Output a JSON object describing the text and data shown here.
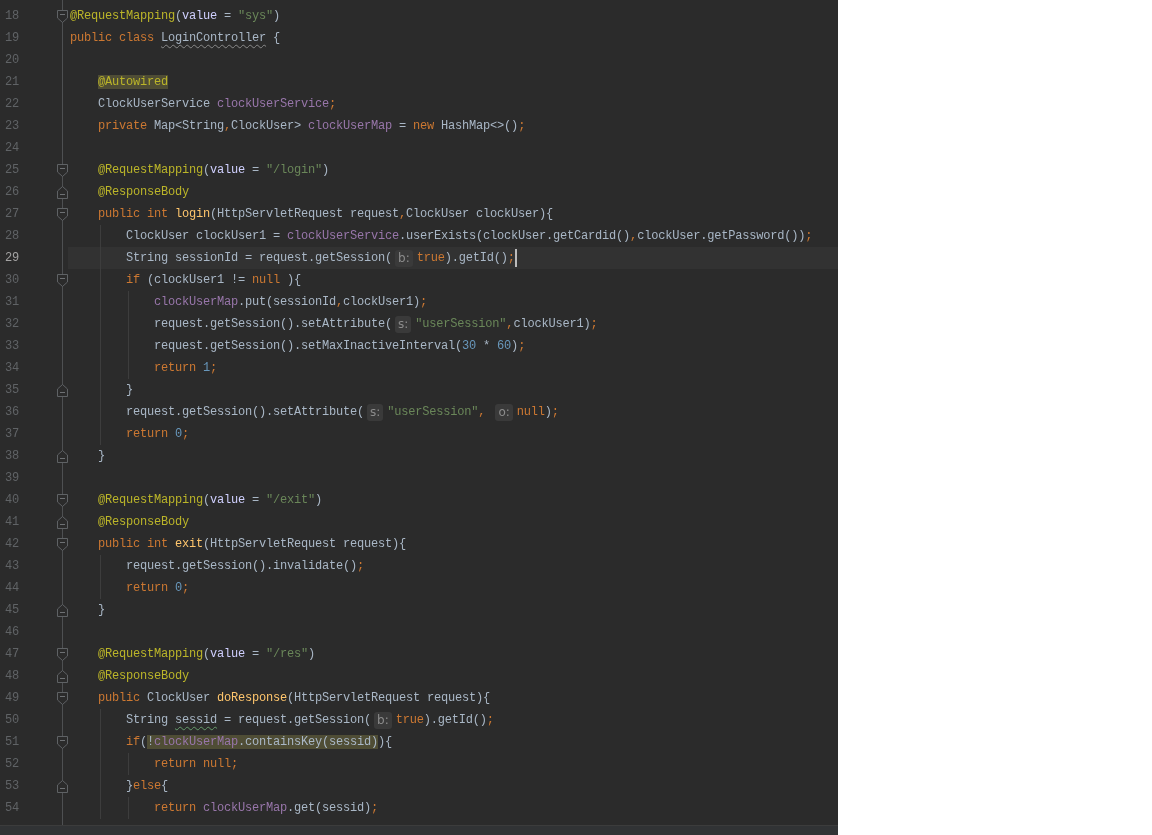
{
  "editor": {
    "lines": [
      {
        "number": "18",
        "current": false,
        "fold": {
          "kind": "start"
        },
        "tokens": [
          {
            "kind": "annotation",
            "text": "@RequestMapping"
          },
          {
            "kind": "plain",
            "text": "("
          },
          {
            "kind": "attribute",
            "text": "value"
          },
          {
            "kind": "plain",
            "text": " = "
          },
          {
            "kind": "string",
            "text": "\"sys\""
          },
          {
            "kind": "plain",
            "text": ")"
          }
        ]
      },
      {
        "number": "19",
        "current": false,
        "tokens": [
          {
            "kind": "keyword",
            "text": "public class "
          },
          {
            "kind": "plain",
            "text": "LoginController",
            "squiggle": {
              "kind": "weak"
            }
          },
          {
            "kind": "plain",
            "text": " {"
          }
        ]
      },
      {
        "number": "20",
        "current": false
      },
      {
        "number": "21",
        "current": false,
        "tokens": [
          {
            "kind": "annotation",
            "text": "    @Autowired",
            "highlight": true
          }
        ]
      },
      {
        "number": "22",
        "current": false,
        "tokens": [
          {
            "kind": "plain",
            "text": "    ClockUserService "
          },
          {
            "kind": "field",
            "text": "clockUserService"
          },
          {
            "kind": "punct",
            "text": ";"
          }
        ]
      },
      {
        "number": "23",
        "current": false,
        "tokens": [
          {
            "kind": "keyword",
            "text": "    private "
          },
          {
            "kind": "plain",
            "text": "Map<String"
          },
          {
            "kind": "punct",
            "text": ","
          },
          {
            "kind": "plain",
            "text": "ClockUser> "
          },
          {
            "kind": "field",
            "text": "clockUserMap"
          },
          {
            "kind": "plain",
            "text": " = "
          },
          {
            "kind": "keyword",
            "text": "new "
          },
          {
            "kind": "plain",
            "text": "HashMap<>()"
          },
          {
            "kind": "punct",
            "text": ";"
          }
        ]
      },
      {
        "number": "24",
        "current": false
      },
      {
        "number": "25",
        "current": false,
        "fold": {
          "kind": "start"
        },
        "tokens": [
          {
            "kind": "annotation",
            "text": "    @RequestMapping"
          },
          {
            "kind": "plain",
            "text": "("
          },
          {
            "kind": "attribute",
            "text": "value"
          },
          {
            "kind": "plain",
            "text": " = "
          },
          {
            "kind": "string",
            "text": "\"/login\""
          },
          {
            "kind": "plain",
            "text": ")"
          }
        ]
      },
      {
        "number": "26",
        "current": false,
        "fold": {
          "kind": "end"
        },
        "tokens": [
          {
            "kind": "annotation",
            "text": "    @ResponseBody"
          }
        ]
      },
      {
        "number": "27",
        "current": false,
        "fold": {
          "kind": "start"
        },
        "tokens": [
          {
            "kind": "keyword",
            "text": "    public int "
          },
          {
            "kind": "method",
            "text": "login"
          },
          {
            "kind": "plain",
            "text": "(HttpServletRequest request"
          },
          {
            "kind": "punct",
            "text": ","
          },
          {
            "kind": "plain",
            "text": "ClockUser clockUser){"
          }
        ]
      },
      {
        "number": "28",
        "current": false,
        "tokens": [
          {
            "kind": "plain",
            "text": "        ClockUser clockUser1 = "
          },
          {
            "kind": "field",
            "text": "clockUserService"
          },
          {
            "kind": "plain",
            "text": ".userExists(clockUser.getCardid()"
          },
          {
            "kind": "punct",
            "text": ","
          },
          {
            "kind": "plain",
            "text": "clockUser.getPassword())"
          },
          {
            "kind": "punct",
            "text": ";"
          }
        ]
      },
      {
        "number": "29",
        "current": true,
        "tokens": [
          {
            "kind": "plain",
            "text": "        String sessionId = request.getSession("
          },
          {
            "kind": "hint",
            "text": "b:"
          },
          {
            "kind": "keyword",
            "text": "true"
          },
          {
            "kind": "plain",
            "text": ").getId()"
          },
          {
            "kind": "punct",
            "text": ";"
          }
        ]
      },
      {
        "number": "30",
        "current": false,
        "fold": {
          "kind": "start"
        },
        "tokens": [
          {
            "kind": "keyword",
            "text": "        if "
          },
          {
            "kind": "plain",
            "text": "(clockUser1 != "
          },
          {
            "kind": "keyword",
            "text": "null"
          },
          {
            "kind": "plain",
            "text": " ){"
          }
        ]
      },
      {
        "number": "31",
        "current": false,
        "tokens": [
          {
            "kind": "field",
            "text": "            clockUserMap"
          },
          {
            "kind": "plain",
            "text": ".put(sessionId"
          },
          {
            "kind": "punct",
            "text": ","
          },
          {
            "kind": "plain",
            "text": "clockUser1)"
          },
          {
            "kind": "punct",
            "text": ";"
          }
        ]
      },
      {
        "number": "32",
        "current": false,
        "tokens": [
          {
            "kind": "plain",
            "text": "            request.getSession().setAttribute("
          },
          {
            "kind": "hint",
            "text": "s:"
          },
          {
            "kind": "string",
            "text": "\"userSession\""
          },
          {
            "kind": "punct",
            "text": ","
          },
          {
            "kind": "plain",
            "text": "clockUser1)"
          },
          {
            "kind": "punct",
            "text": ";"
          }
        ]
      },
      {
        "number": "33",
        "current": false,
        "tokens": [
          {
            "kind": "plain",
            "text": "            request.getSession().setMaxInactiveInterval("
          },
          {
            "kind": "number",
            "text": "30"
          },
          {
            "kind": "plain",
            "text": " * "
          },
          {
            "kind": "number",
            "text": "60"
          },
          {
            "kind": "plain",
            "text": ")"
          },
          {
            "kind": "punct",
            "text": ";"
          }
        ]
      },
      {
        "number": "34",
        "current": false,
        "tokens": [
          {
            "kind": "keyword",
            "text": "            return "
          },
          {
            "kind": "number",
            "text": "1"
          },
          {
            "kind": "punct",
            "text": ";"
          }
        ]
      },
      {
        "number": "35",
        "current": false,
        "fold": {
          "kind": "end"
        },
        "tokens": [
          {
            "kind": "plain",
            "text": "        }"
          }
        ]
      },
      {
        "number": "36",
        "current": false,
        "tokens": [
          {
            "kind": "plain",
            "text": "        request.getSession().setAttribute("
          },
          {
            "kind": "hint",
            "text": "s:"
          },
          {
            "kind": "string",
            "text": "\"userSession\""
          },
          {
            "kind": "punct",
            "text": ", "
          },
          {
            "kind": "hint",
            "text": "o:"
          },
          {
            "kind": "keyword",
            "text": "null"
          },
          {
            "kind": "plain",
            "text": ")"
          },
          {
            "kind": "punct",
            "text": ";"
          }
        ]
      },
      {
        "number": "37",
        "current": false,
        "tokens": [
          {
            "kind": "keyword",
            "text": "        return "
          },
          {
            "kind": "number",
            "text": "0"
          },
          {
            "kind": "punct",
            "text": ";"
          }
        ]
      },
      {
        "number": "38",
        "current": false,
        "fold": {
          "kind": "end"
        },
        "tokens": [
          {
            "kind": "plain",
            "text": "    }"
          }
        ]
      },
      {
        "number": "39",
        "current": false
      },
      {
        "number": "40",
        "current": false,
        "fold": {
          "kind": "start"
        },
        "tokens": [
          {
            "kind": "annotation",
            "text": "    @RequestMapping"
          },
          {
            "kind": "plain",
            "text": "("
          },
          {
            "kind": "attribute",
            "text": "value"
          },
          {
            "kind": "plain",
            "text": " = "
          },
          {
            "kind": "string",
            "text": "\"/exit\""
          },
          {
            "kind": "plain",
            "text": ")"
          }
        ]
      },
      {
        "number": "41",
        "current": false,
        "fold": {
          "kind": "end"
        },
        "tokens": [
          {
            "kind": "annotation",
            "text": "    @ResponseBody"
          }
        ]
      },
      {
        "number": "42",
        "current": false,
        "fold": {
          "kind": "start"
        },
        "tokens": [
          {
            "kind": "keyword",
            "text": "    public int "
          },
          {
            "kind": "method",
            "text": "exit"
          },
          {
            "kind": "plain",
            "text": "(HttpServletRequest request){"
          }
        ]
      },
      {
        "number": "43",
        "current": false,
        "tokens": [
          {
            "kind": "plain",
            "text": "        request.getSession().invalidate()"
          },
          {
            "kind": "punct",
            "text": ";"
          }
        ]
      },
      {
        "number": "44",
        "current": false,
        "tokens": [
          {
            "kind": "keyword",
            "text": "        return "
          },
          {
            "kind": "number",
            "text": "0"
          },
          {
            "kind": "punct",
            "text": ";"
          }
        ]
      },
      {
        "number": "45",
        "current": false,
        "fold": {
          "kind": "end"
        },
        "tokens": [
          {
            "kind": "plain",
            "text": "    }"
          }
        ]
      },
      {
        "number": "46",
        "current": false
      },
      {
        "number": "47",
        "current": false,
        "fold": {
          "kind": "start"
        },
        "tokens": [
          {
            "kind": "annotation",
            "text": "    @RequestMapping"
          },
          {
            "kind": "plain",
            "text": "("
          },
          {
            "kind": "attribute",
            "text": "value"
          },
          {
            "kind": "plain",
            "text": " = "
          },
          {
            "kind": "string",
            "text": "\"/res\""
          },
          {
            "kind": "plain",
            "text": ")"
          }
        ]
      },
      {
        "number": "48",
        "current": false,
        "fold": {
          "kind": "end"
        },
        "tokens": [
          {
            "kind": "annotation",
            "text": "    @ResponseBody"
          }
        ]
      },
      {
        "number": "49",
        "current": false,
        "fold": {
          "kind": "start"
        },
        "tokens": [
          {
            "kind": "keyword",
            "text": "    public "
          },
          {
            "kind": "plain",
            "text": "ClockUser "
          },
          {
            "kind": "method",
            "text": "doResponse"
          },
          {
            "kind": "plain",
            "text": "(HttpServletRequest request){"
          }
        ]
      },
      {
        "number": "50",
        "current": false,
        "tokens": [
          {
            "kind": "plain",
            "text": "        String "
          },
          {
            "kind": "plain",
            "text": "sessid",
            "squiggle": {
              "kind": "typo"
            }
          },
          {
            "kind": "plain",
            "text": " = request.getSession("
          },
          {
            "kind": "hint",
            "text": "b:"
          },
          {
            "kind": "keyword",
            "text": "true"
          },
          {
            "kind": "plain",
            "text": ").getId()"
          },
          {
            "kind": "punct",
            "text": ";"
          }
        ]
      },
      {
        "number": "51",
        "current": false,
        "fold": {
          "kind": "start"
        },
        "tokens": [
          {
            "kind": "keyword",
            "text": "        if"
          },
          {
            "kind": "plain",
            "text": "("
          },
          {
            "kind": "plain",
            "text": "!",
            "highlight": true
          },
          {
            "kind": "field",
            "text": "clockUserMap",
            "highlight": true
          },
          {
            "kind": "plain",
            "text": ".containsKey(sessid)",
            "highlight": true
          },
          {
            "kind": "plain",
            "text": "){"
          }
        ]
      },
      {
        "number": "52",
        "current": false,
        "tokens": [
          {
            "kind": "keyword",
            "text": "            return null"
          },
          {
            "kind": "punct",
            "text": ";"
          }
        ]
      },
      {
        "number": "53",
        "current": false,
        "fold": {
          "kind": "end"
        },
        "tokens": [
          {
            "kind": "plain",
            "text": "        }"
          },
          {
            "kind": "keyword",
            "text": "else"
          },
          {
            "kind": "plain",
            "text": "{"
          }
        ]
      },
      {
        "number": "54",
        "current": false,
        "tokens": [
          {
            "kind": "keyword",
            "text": "            return "
          },
          {
            "kind": "field",
            "text": "clockUserMap"
          },
          {
            "kind": "plain",
            "text": ".get(sessid)"
          },
          {
            "kind": "punct",
            "text": ";"
          }
        ]
      }
    ]
  }
}
